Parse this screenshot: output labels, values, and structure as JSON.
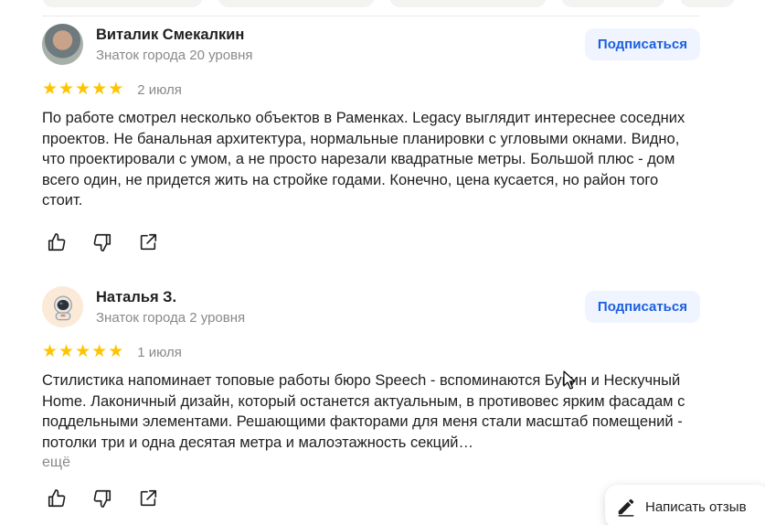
{
  "reviews": [
    {
      "author": "Виталик Смекалкин",
      "level": "Знаток города 20 уровня",
      "subscribe_label": "Подписаться",
      "rating": 5,
      "date": "2 июля",
      "text": "По работе смотрел несколько объектов в Раменках. Legacy выглядит интереснее соседних проектов. Не банальная архитектура, нормальные планировки с угловыми окнами. Видно, что проектировали с умом, а не просто нарезали квадратные метры. Большой плюс - дом всего один, не придется жить на стройке годами. Конечно, цена кусается, но район того стоит.",
      "more_label": ""
    },
    {
      "author": "Наталья З.",
      "level": "Знаток города 2 уровня",
      "subscribe_label": "Подписаться",
      "rating": 5,
      "date": "1 июля",
      "text": "Стилистика напоминает топовые работы бюро Speech - вспоминаются Бунин и Нескучный Home. Лаконичный дизайн, который останется актуальным, в противовес ярким фасадам с поддельными элементами. Решающими факторами для меня стали масштаб помещений - потолки три и одна десятая метра и малоэтажность секций…",
      "more_label": "ещё"
    }
  ],
  "icons": {
    "like": "thumbs-up-icon",
    "dislike": "thumbs-down-icon",
    "share": "share-icon",
    "write": "pencil-icon"
  },
  "colors": {
    "star": "#fdc500",
    "subscribe_bg": "#eff4ff",
    "subscribe_text": "#1b5fe0",
    "muted": "#898989"
  },
  "write_review_label": "Написать отзыв"
}
